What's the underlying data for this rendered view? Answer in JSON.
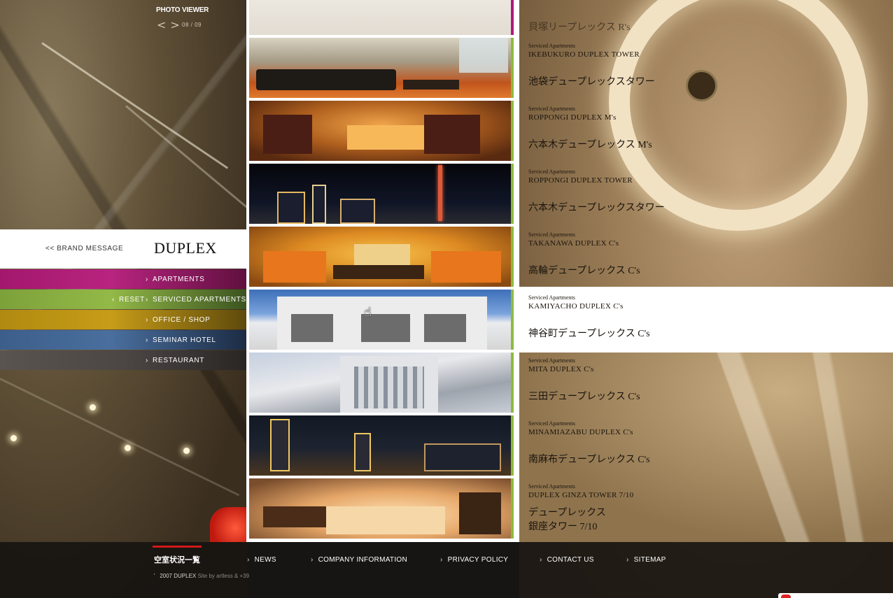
{
  "photo_viewer": {
    "title": "PHOTO VIEWER",
    "prev": "<",
    "next": ">",
    "counter": "08 / 09"
  },
  "brand": {
    "message": "<< BRAND MESSAGE",
    "logo": "DUPLEX"
  },
  "nav": {
    "apartments": "APARTMENTS",
    "serviced": "SERVICED APARTMENTS",
    "reset": "RESET",
    "office": "OFFICE / SHOP",
    "seminar": "SEMINAR HOTEL",
    "restaurant": "RESTAURANT"
  },
  "colors": {
    "apartments": "#b0187a",
    "serviced": "#8dbb3d",
    "office": "#c79c18",
    "seminar": "#4a6f9e",
    "restaurant": "#4c4644",
    "footer_accent": "#d01818"
  },
  "top_partial": "貝塚リープレックス R's",
  "properties": [
    {
      "kicker": "Serviced Apartments",
      "en": "IKEBUKURO DUPLEX TOWER",
      "jp": "池袋デュープレックスタワー"
    },
    {
      "kicker": "Serviced Apartments",
      "en": "ROPPONGI DUPLEX M's",
      "jp": "六本木デュープレックス M's"
    },
    {
      "kicker": "Serviced Apartments",
      "en": "ROPPONGI DUPLEX TOWER",
      "jp": "六本木デュープレックスタワー"
    },
    {
      "kicker": "Serviced Apartments",
      "en": "TAKANAWA DUPLEX C's",
      "jp": "高輪デュープレックス C's"
    },
    {
      "kicker": "Serviced Apartments",
      "en": "KAMIYACHO DUPLEX C's",
      "jp": "神谷町デュープレックス C's"
    },
    {
      "kicker": "Serviced Apartments",
      "en": "MITA DUPLEX C's",
      "jp": "三田デュープレックス C's"
    },
    {
      "kicker": "Serviced Apartments",
      "en": "MINAMIAZABU DUPLEX C's",
      "jp": "南麻布デュープレックス C's"
    },
    {
      "kicker": "Serviced Apartments",
      "en": "DUPLEX GINZA TOWER 7/10",
      "jp": "デュープレックス",
      "jp2": "銀座タワー 7/10"
    }
  ],
  "footer": {
    "vacancy": "空室状況一覧",
    "copyright_mark": "'",
    "copyright": "2007 DUPLEX",
    "credit": "Site by artless & +39",
    "links": [
      "NEWS",
      "COMPANY INFORMATION",
      "PRIVACY POLICY",
      "CONTACT US",
      "SITEMAP"
    ]
  },
  "icons": {
    "prev": "chevron-left-icon",
    "next": "chevron-right-icon",
    "cursor": "hand-pointer-icon"
  }
}
